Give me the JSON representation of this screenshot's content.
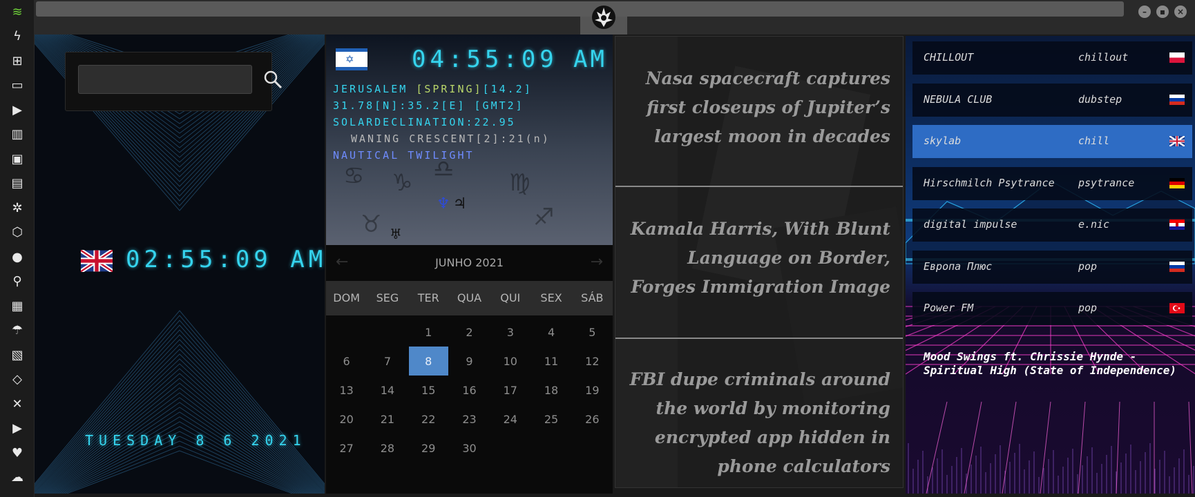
{
  "sidebar": {
    "icons": [
      "wifi-icon",
      "lightning-icon",
      "windows-icon",
      "archive-icon",
      "play-icon",
      "map-book-icon",
      "image-icon",
      "news-icon",
      "film-reel-icon",
      "hexagon-icon",
      "globe-icon",
      "search-icon",
      "map-icon",
      "umbrella-icon",
      "contacts-icon",
      "code-icon",
      "expand-icon",
      "youtube-icon",
      "heart-icon",
      "cloud-icon"
    ]
  },
  "window": {
    "minimize": "–",
    "maximize": "▪",
    "close": "×"
  },
  "uk_clock": {
    "search_value": "",
    "time": "02:55:09 AM",
    "date": "TUESDAY 8 6 2021"
  },
  "jerusalem": {
    "time": "04:55:09",
    "ampm": "AM",
    "line1_a": "JERUSALEM ",
    "line1_season": "[SPRING]",
    "line1_b": "[14.2]",
    "line2": "31.78[N]:35.2[E] [GMT2]",
    "line3": "SOLARDECLINATION:22.95",
    "line4": "WANING CRESCENT[2]:21",
    "line4_suffix": "(n)",
    "line5": "NAUTICAL TWILIGHT",
    "planet_neptune": "♆",
    "planet_jupiter": "♃",
    "planet_uranus": "♅"
  },
  "calendar": {
    "title": "JUNHO 2021",
    "prev": "←",
    "next": "→",
    "weekdays": [
      "DOM",
      "SEG",
      "TER",
      "QUA",
      "QUI",
      "SEX",
      "SÁB"
    ],
    "leading_blanks": 2,
    "days": [
      "1",
      "2",
      "3",
      "4",
      "5",
      "6",
      "7",
      "8",
      "9",
      "10",
      "11",
      "12",
      "13",
      "14",
      "15",
      "16",
      "17",
      "18",
      "19",
      "20",
      "21",
      "22",
      "23",
      "24",
      "25",
      "26",
      "27",
      "28",
      "29",
      "30"
    ],
    "selected": "8"
  },
  "news": [
    {
      "headline": "Nasa spacecraft captures first closeups of Jupiter’s largest moon in decades"
    },
    {
      "headline": "Kamala Harris, With Blunt Language on Border, Forges Immigration Image"
    },
    {
      "headline": "FBI dupe criminals around the world by monitoring encrypted app hidden in phone calculators"
    }
  ],
  "radio": {
    "stations": [
      {
        "name": "CHILLOUT",
        "genre": "chillout",
        "flag": "pl"
      },
      {
        "name": "NEBULA CLUB",
        "genre": "dubstep",
        "flag": "ru"
      },
      {
        "name": "skylab",
        "genre": "chill",
        "flag": "gb",
        "active": true
      },
      {
        "name": "Hirschmilch Psytrance",
        "genre": "psytrance",
        "flag": "de"
      },
      {
        "name": "digital impulse",
        "genre": "e.nic",
        "flag": "hr"
      },
      {
        "name": "Европа Плюс",
        "genre": "pop",
        "flag": "ru"
      },
      {
        "name": "Power FM",
        "genre": "pop",
        "flag": "tr"
      }
    ],
    "now_playing": "Mood Swings ft. Chrissie Hynde - Spiritual High (State of Independence)"
  }
}
